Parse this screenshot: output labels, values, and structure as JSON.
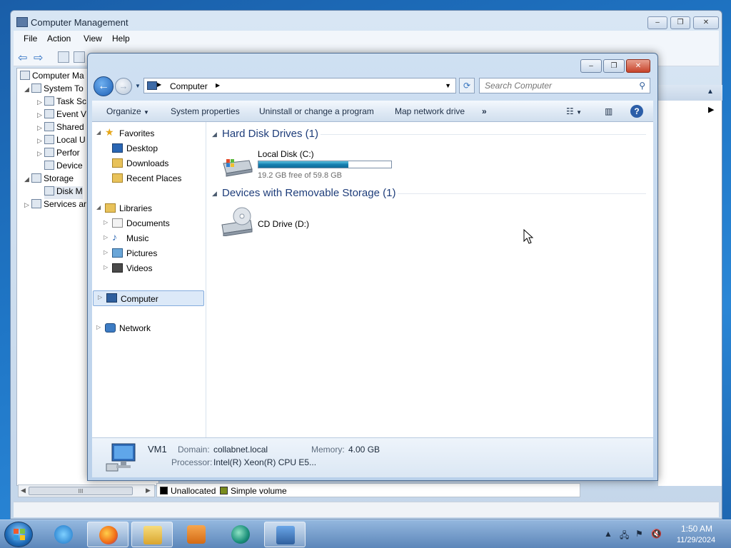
{
  "computer_management": {
    "title": "Computer Management",
    "menu": [
      "File",
      "Action",
      "View",
      "Help"
    ],
    "tree": [
      {
        "label": "Computer Ma",
        "level": 0
      },
      {
        "label": "System To",
        "level": 1
      },
      {
        "label": "Task Sc",
        "level": 2
      },
      {
        "label": "Event V",
        "level": 2
      },
      {
        "label": "Shared",
        "level": 2
      },
      {
        "label": "Local U",
        "level": 2
      },
      {
        "label": "Perfor",
        "level": 2
      },
      {
        "label": "Device",
        "level": 2
      },
      {
        "label": "Storage",
        "level": 1
      },
      {
        "label": "Disk M",
        "level": 2
      },
      {
        "label": "Services ar",
        "level": 1
      }
    ],
    "legend": {
      "unallocated": "Unallocated",
      "simple": "Simple volume",
      "unallocated_color": "#000000",
      "simple_color": "#7a8c1e"
    },
    "hscroll_glyph": "III"
  },
  "explorer": {
    "address": "Computer",
    "search_placeholder": "Search Computer",
    "commands": {
      "organize": "Organize",
      "system_properties": "System properties",
      "uninstall": "Uninstall or change a program",
      "map_drive": "Map network drive",
      "more": "»"
    },
    "nav": {
      "favorites": "Favorites",
      "desktop": "Desktop",
      "downloads": "Downloads",
      "recent": "Recent Places",
      "libraries": "Libraries",
      "documents": "Documents",
      "music": "Music",
      "pictures": "Pictures",
      "videos": "Videos",
      "computer": "Computer",
      "network": "Network"
    },
    "groups": {
      "hdd_header": "Hard Disk Drives (1)",
      "removable_header": "Devices with Removable Storage (1)"
    },
    "drive_c": {
      "name": "Local Disk (C:)",
      "free_text": "19.2 GB free of 59.8 GB",
      "used_fraction": 0.68
    },
    "drive_d": {
      "name": "CD Drive (D:)"
    },
    "details": {
      "name": "VM1",
      "domain_label": "Domain:",
      "domain": "collabnet.local",
      "memory_label": "Memory:",
      "memory": "4.00 GB",
      "processor_label": "Processor:",
      "processor": "Intel(R) Xeon(R) CPU E5..."
    }
  },
  "taskbar": {
    "time": "1:50 AM",
    "date": "11/29/2024"
  },
  "colors": {
    "accent": "#1e3d7a",
    "drive_bar": "#177fb0"
  }
}
